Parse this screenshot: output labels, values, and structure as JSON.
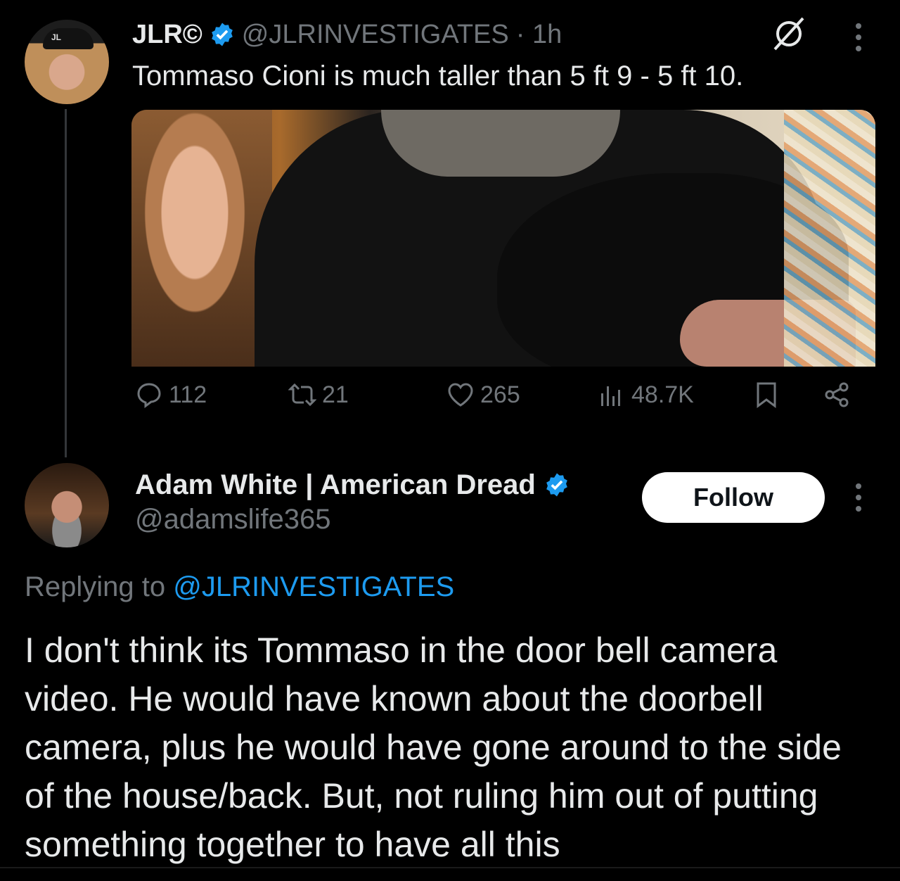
{
  "tweet": {
    "author_name": "JLR©",
    "author_handle": "@JLRINVESTIGATES",
    "time": "· 1h",
    "text": "Tommaso Cioni is much taller than 5 ft 9 - 5 ft 10.",
    "avatar_cap_text": "JL",
    "stats": {
      "replies": "112",
      "reposts": "21",
      "likes": "265",
      "views": "48.7K"
    }
  },
  "reply": {
    "author_name": "Adam White | American Dread",
    "author_handle": "@adamslife365",
    "follow_label": "Follow",
    "replying_prefix": "Replying to",
    "replying_mention": "@JLRINVESTIGATES",
    "text": "I don't think its Tommaso in the door bell camera video. He would have known about the doorbell camera, plus he would have gone around to the side of the house/back. But, not ruling him out of putting something together to have all this"
  },
  "colors": {
    "background": "#000000",
    "text_primary": "#e7e9ea",
    "text_secondary": "#71767b",
    "accent_blue": "#1d9bf0",
    "follow_bg": "#ffffff"
  },
  "icons": {
    "verified": "verified-badge-icon",
    "grok": "circle-slash-icon",
    "more": "more-vertical-icon",
    "reply": "reply-icon",
    "repost": "repost-icon",
    "like": "heart-icon",
    "views": "views-icon",
    "bookmark": "bookmark-icon",
    "share": "share-icon"
  }
}
